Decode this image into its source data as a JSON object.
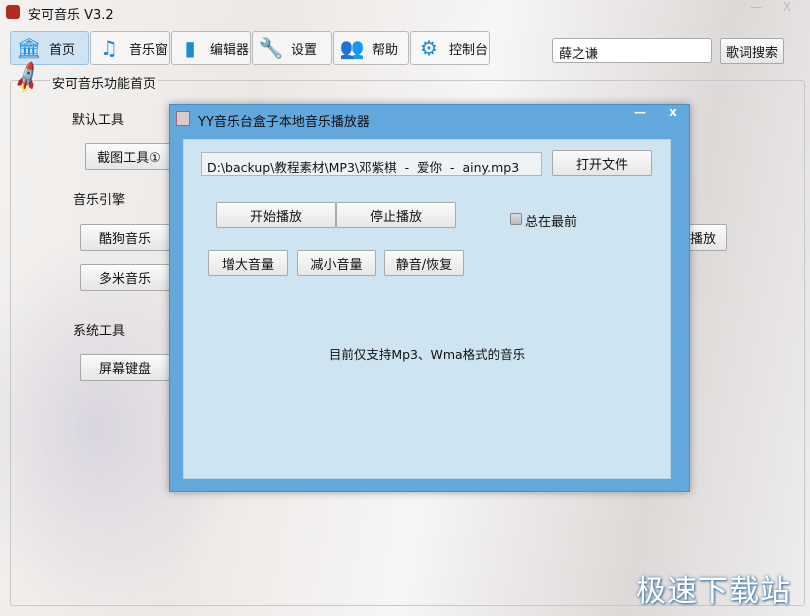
{
  "window": {
    "title": "安可音乐 V3.2",
    "minimize": "—",
    "close": "X"
  },
  "toolbar": [
    {
      "label": "首页",
      "icon": "bank-icon",
      "glyph": "🏛"
    },
    {
      "label": "音乐窗",
      "icon": "music-note-icon",
      "glyph": "♫"
    },
    {
      "label": "编辑器",
      "icon": "document-icon",
      "glyph": "▮"
    },
    {
      "label": "设置",
      "icon": "wrench-icon",
      "glyph": "🔧"
    },
    {
      "label": "帮助",
      "icon": "users-icon",
      "glyph": "👥"
    },
    {
      "label": "控制台",
      "icon": "gear-icon",
      "glyph": "⚙"
    }
  ],
  "search": {
    "value": "薛之谦",
    "button": "歌词搜索"
  },
  "group": {
    "title": "安可音乐功能首页",
    "sections": [
      {
        "label": "默认工具",
        "buttons": [
          "截图工具①"
        ]
      },
      {
        "label": "音乐引擎",
        "buttons": [
          "酷狗音乐",
          "多米音乐"
        ]
      },
      {
        "label": "系统工具",
        "buttons": [
          "屏幕键盘"
        ]
      }
    ],
    "partial_button": "播放"
  },
  "dialog": {
    "title": "YY音乐台盒子本地音乐播放器",
    "minimize": "—",
    "close": "x",
    "path": "D:\\backup\\教程素材\\MP3\\邓紫棋  -  爱你  -  ainy.mp3",
    "open_file": "打开文件",
    "play": "开始播放",
    "stop": "停止播放",
    "always_on_top": "总在最前",
    "always_on_top_checked": false,
    "vol_up": "增大音量",
    "vol_down": "减小音量",
    "mute": "静音/恢复",
    "note": "目前仅支持Mp3、Wma格式的音乐"
  },
  "watermark": "极速下载站"
}
